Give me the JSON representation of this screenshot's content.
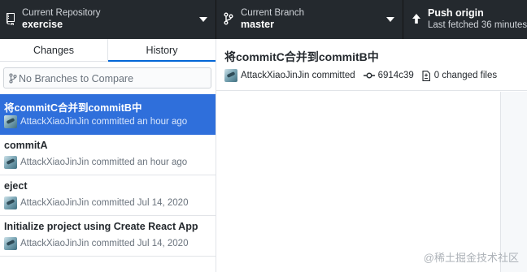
{
  "toolbar": {
    "repository": {
      "label": "Current Repository",
      "value": "exercise"
    },
    "branch": {
      "label": "Current Branch",
      "value": "master"
    },
    "push": {
      "label": "Push origin",
      "value": "Last fetched 36 minutes"
    }
  },
  "sidebar": {
    "tabs": [
      {
        "label": "Changes"
      },
      {
        "label": "History"
      }
    ],
    "compare_placeholder": "No Branches to Compare",
    "history": [
      {
        "title": "将commitC合并到commitB中",
        "sub": "AttackXiaoJinJin committed an hour ago"
      },
      {
        "title": "commitA",
        "sub": "AttackXiaoJinJin committed an hour ago"
      },
      {
        "title": "eject",
        "sub": "AttackXiaoJinJin committed Jul 14, 2020"
      },
      {
        "title": "Initialize project using Create React App",
        "sub": "AttackXiaoJinJin committed Jul 14, 2020"
      }
    ]
  },
  "commit": {
    "title": "将commitC合并到commitB中",
    "author": "AttackXiaoJinJin committed",
    "sha": "6914c39",
    "changed_files": "0 changed files"
  },
  "watermark": "@稀土掘金技术社区",
  "colors": {
    "toolbar": "#24292e",
    "selected": "#2f6fdb",
    "accent": "#0366d6"
  }
}
